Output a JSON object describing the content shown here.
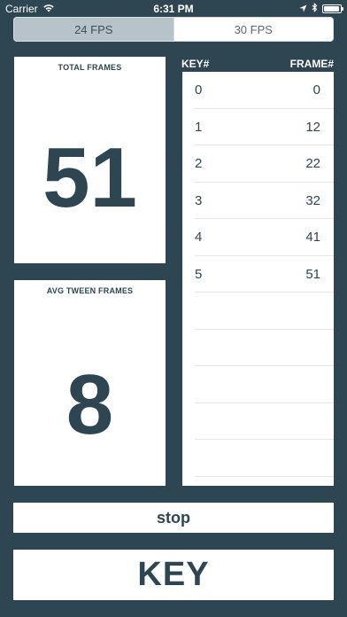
{
  "status_bar": {
    "carrier": "Carrier",
    "time": "6:31 PM"
  },
  "fps_selector": {
    "options": [
      "24 FPS",
      "30 FPS"
    ],
    "selected": "24 FPS"
  },
  "total_frames": {
    "label": "TOTAL FRAMES",
    "value": "51"
  },
  "avg_tween_frames": {
    "label": "AVG TWEEN FRAMES",
    "value": "8"
  },
  "key_table": {
    "headers": {
      "key": "KEY#",
      "frame": "FRAME#"
    },
    "rows": [
      {
        "key": "0",
        "frame": "0"
      },
      {
        "key": "1",
        "frame": "12"
      },
      {
        "key": "2",
        "frame": "22"
      },
      {
        "key": "3",
        "frame": "32"
      },
      {
        "key": "4",
        "frame": "41"
      },
      {
        "key": "5",
        "frame": "51"
      },
      {
        "key": "",
        "frame": ""
      },
      {
        "key": "",
        "frame": ""
      },
      {
        "key": "",
        "frame": ""
      },
      {
        "key": "",
        "frame": ""
      },
      {
        "key": "",
        "frame": ""
      }
    ]
  },
  "buttons": {
    "stop_label": "stop",
    "key_label": "KEY"
  },
  "icons": {
    "wifi": "wifi-icon",
    "location": "location-arrow-icon",
    "bluetooth": "bluetooth-icon",
    "battery": "battery-icon"
  },
  "colors": {
    "background": "#2e4651",
    "panel": "#ffffff",
    "segment_selected": "#b7c3c9"
  }
}
